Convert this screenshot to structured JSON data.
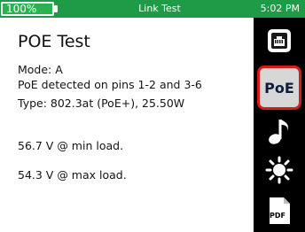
{
  "status": {
    "battery": "100%",
    "battery_level_percent": 100,
    "title": "Link Test",
    "time": "5:02 PM"
  },
  "page": {
    "title": "POE Test",
    "mode": "Mode: A",
    "detected": "PoE detected on pins 1-2 and 3-6",
    "type": "Type: 802.3at (PoE+), 25.50W",
    "min_load": "56.7 V @ min load.",
    "max_load": "54.3 V @ max load."
  },
  "sidebar": {
    "items": [
      {
        "icon": "network-port-icon",
        "label": ""
      },
      {
        "icon": "poe-icon",
        "label": "PoE"
      },
      {
        "icon": "tone-icon",
        "label": ""
      },
      {
        "icon": "brightness-icon",
        "label": ""
      },
      {
        "icon": "pdf-icon",
        "label": "PDF"
      }
    ],
    "active_index": 1,
    "active_border_color": "#d21d1d"
  },
  "colors": {
    "status_bar": "#1f9a47",
    "sidebar": "#000000"
  }
}
